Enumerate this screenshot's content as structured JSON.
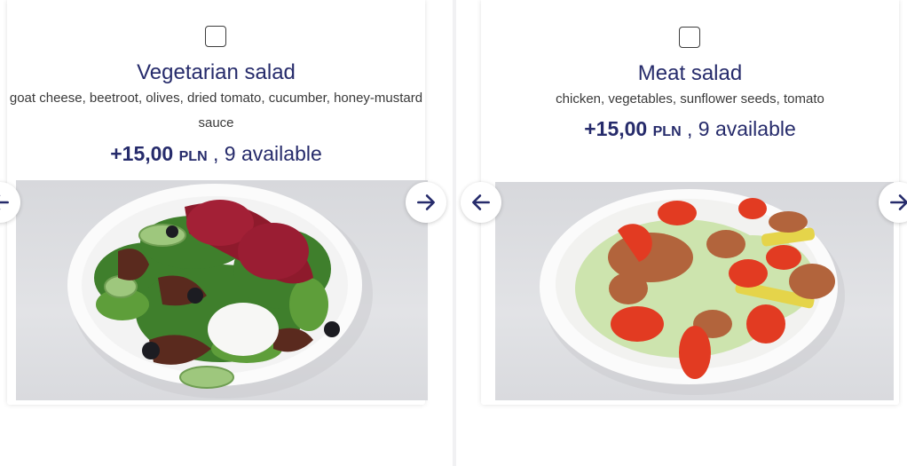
{
  "cards": [
    {
      "title": "Vegetarian salad",
      "description": "goat cheese, beetroot, olives, dried tomato, cucumber, honey-mustard sauce",
      "price": "+15,00",
      "currency": "PLN",
      "availability": ", 9 available",
      "image_icon": "salad-vegetarian-photo"
    },
    {
      "title": "Meat salad",
      "description": "chicken, vegetables, sunflower seeds, tomato",
      "price": "+15,00",
      "currency": "PLN",
      "availability": ", 9 available",
      "image_icon": "salad-meat-photo"
    }
  ],
  "colors": {
    "accent": "#262b6b",
    "text": "#3a3a3a",
    "background": "#f1f1f3"
  }
}
